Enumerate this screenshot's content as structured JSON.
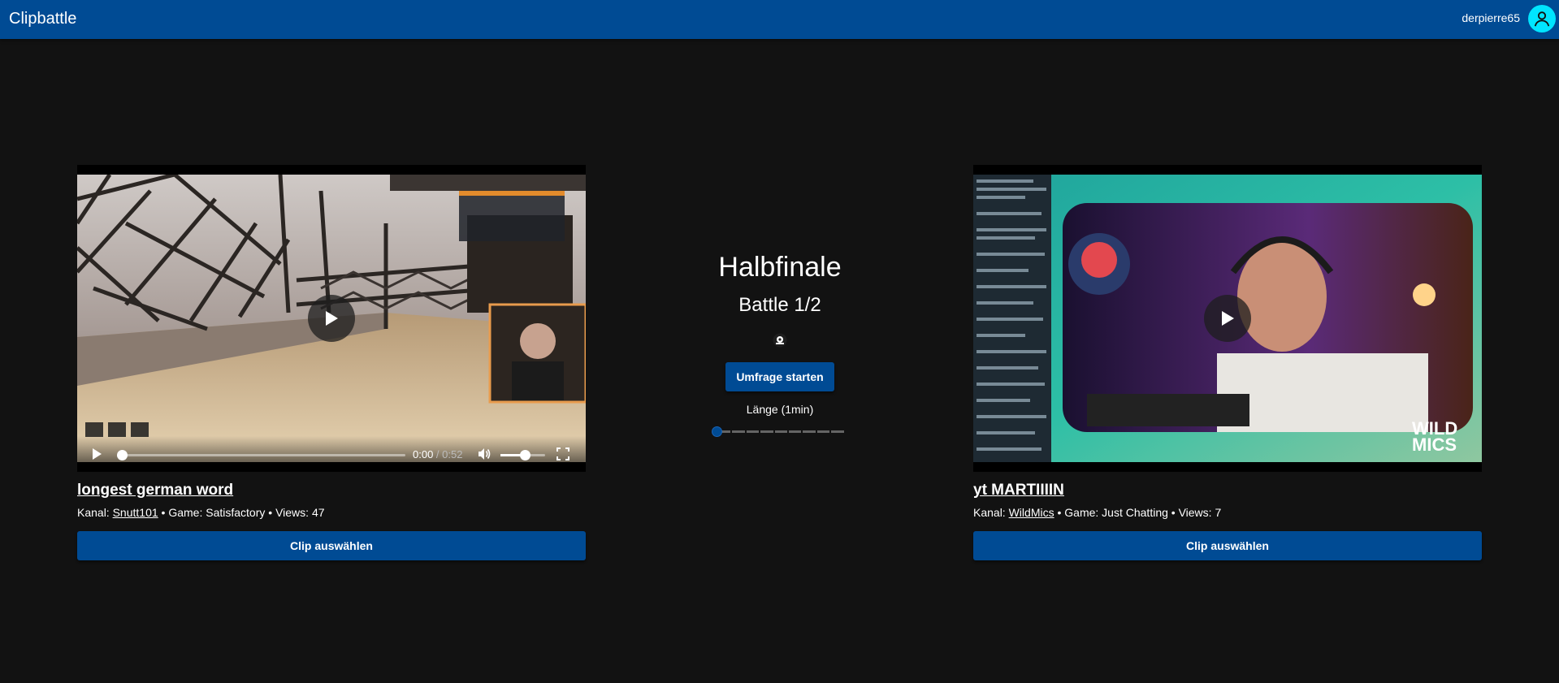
{
  "app": {
    "title": "Clipbattle"
  },
  "user": {
    "name": "derpierre65"
  },
  "colors": {
    "primary": "#004b94",
    "avatar": "#00e5ff",
    "background": "#121212"
  },
  "battle": {
    "round": "Halbfinale",
    "battle": "Battle 1/2",
    "poll_button": "Umfrage starten",
    "length_label": "Länge (1min)",
    "length_value": 0,
    "icon": "badge-icon"
  },
  "clips": [
    {
      "title": "longest german word",
      "channel_prefix": "Kanal:",
      "channel": "Snutt101",
      "game": " • Game: Satisfactory",
      "views": " • Views: 47",
      "time_current": "0:00",
      "time_separator": " / ",
      "time_duration": "0:52",
      "select_button": "Clip auswählen"
    },
    {
      "title": "yt MARTIIIIN",
      "channel_prefix": "Kanal:",
      "channel": "WildMics",
      "game": " • Game: Just Chatting",
      "views": " • Views: 7",
      "select_button": "Clip auswählen"
    }
  ]
}
